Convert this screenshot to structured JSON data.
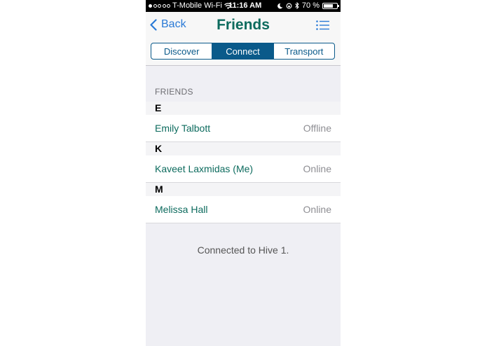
{
  "status_bar": {
    "carrier": "T-Mobile Wi-Fi",
    "time": "11:16 AM",
    "battery": "70 %",
    "battery_level": 0.7
  },
  "nav": {
    "back_label": "Back",
    "title": "Friends"
  },
  "tabs": [
    {
      "label": "Discover",
      "active": false
    },
    {
      "label": "Connect",
      "active": true
    },
    {
      "label": "Transport",
      "active": false
    }
  ],
  "friends_section": {
    "header": "FRIENDS",
    "groups": [
      {
        "letter": "E",
        "name": "Emily Talbott",
        "status": "Offline"
      },
      {
        "letter": "K",
        "name": "Kaveet Laxmidas (Me)",
        "status": "Online"
      },
      {
        "letter": "M",
        "name": "Melissa Hall",
        "status": "Online"
      }
    ]
  },
  "footer": {
    "message": "Connected to Hive 1."
  },
  "colors": {
    "accent_green": "#0d6b5e",
    "segment_blue": "#0a5a8a",
    "back_blue": "#2a7ad6"
  }
}
